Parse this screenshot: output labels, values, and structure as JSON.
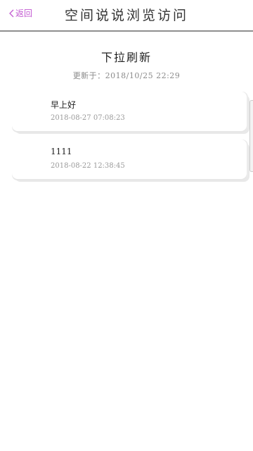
{
  "header": {
    "back_label": "返回",
    "title": "空间说说浏览访问"
  },
  "refresh": {
    "label": "下拉刷新",
    "updated_text": "更新于：2018/10/25  22:29"
  },
  "posts": [
    {
      "content": "早上好",
      "date": "2018-08-27 07:08:23"
    },
    {
      "content": "1111",
      "date": "2018-08-22 12:38:45"
    }
  ],
  "colors": {
    "accent": "#c25ad1",
    "header_border": "#8f8f8f"
  },
  "icons": {
    "back": "chevron-left-icon"
  }
}
